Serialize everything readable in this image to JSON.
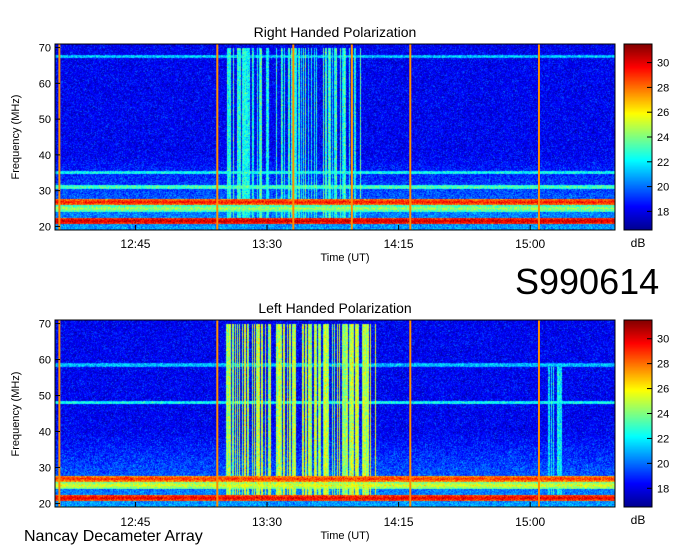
{
  "observation_id": "S990614",
  "instrument": "Nancay Decameter Array",
  "colors": {
    "colormap": [
      "#00008f",
      "#0000ff",
      "#0080ff",
      "#00ffff",
      "#80ff80",
      "#ffff00",
      "#ff8000",
      "#ff0000",
      "#800000"
    ],
    "background": "#ffffff",
    "axis": "#000000"
  },
  "chart_data": [
    {
      "type": "heatmap",
      "title": "Right Handed Polarization",
      "xlabel": "Time (UT)",
      "ylabel": "Frequency (MHz)",
      "x_tick_labels": [
        "12:45",
        "13:30",
        "14:15",
        "15:00"
      ],
      "x_ticks_minutes": [
        765,
        810,
        855,
        900
      ],
      "xlim_minutes": [
        737.5,
        929
      ],
      "y_ticks": [
        20,
        30,
        40,
        50,
        60,
        70
      ],
      "ylim": [
        19,
        71
      ],
      "colorbar": {
        "label": "dB",
        "ticks": [
          18,
          20,
          22,
          24,
          26,
          28,
          30
        ],
        "range": [
          16.5,
          31.5
        ]
      },
      "grid": false,
      "interference_lines_minutes": [
        739,
        793,
        819,
        839,
        859,
        903
      ],
      "band_levels_db": [
        {
          "freq_mhz": 21.5,
          "level": 30.5
        },
        {
          "freq_mhz": 26.8,
          "level": 29.5
        },
        {
          "freq_mhz": 25.0,
          "level": 24.5
        },
        {
          "freq_mhz": 31.0,
          "level": 23.5
        },
        {
          "freq_mhz": 35.0,
          "level": 22.5
        },
        {
          "freq_mhz": 67.5,
          "level": 21.5
        }
      ],
      "burst_activity": [
        {
          "start_minutes": 796,
          "end_minutes": 842,
          "fmin_mhz": 22,
          "fmax_mhz": 70,
          "peak_db": 23
        }
      ]
    },
    {
      "type": "heatmap",
      "title": "Left Handed Polarization",
      "xlabel": "Time (UT)",
      "ylabel": "Frequency (MHz)",
      "x_tick_labels": [
        "12:45",
        "13:30",
        "14:15",
        "15:00"
      ],
      "x_ticks_minutes": [
        765,
        810,
        855,
        900
      ],
      "xlim_minutes": [
        737.5,
        929
      ],
      "y_ticks": [
        20,
        30,
        40,
        50,
        60,
        70
      ],
      "ylim": [
        19,
        71
      ],
      "colorbar": {
        "label": "dB",
        "ticks": [
          18,
          20,
          22,
          24,
          26,
          28,
          30
        ],
        "range": [
          16.5,
          31.5
        ]
      },
      "grid": false,
      "interference_lines_minutes": [
        739,
        793,
        859,
        903
      ],
      "band_levels_db": [
        {
          "freq_mhz": 21.5,
          "level": 30.0
        },
        {
          "freq_mhz": 26.8,
          "level": 29.0
        },
        {
          "freq_mhz": 25.0,
          "level": 25.5
        },
        {
          "freq_mhz": 48.0,
          "level": 22.5
        },
        {
          "freq_mhz": 58.5,
          "level": 21.5
        }
      ],
      "burst_activity": [
        {
          "start_minutes": 794,
          "end_minutes": 848,
          "fmin_mhz": 22,
          "fmax_mhz": 70,
          "peak_db": 25
        },
        {
          "start_minutes": 906,
          "end_minutes": 911,
          "fmin_mhz": 22,
          "fmax_mhz": 58,
          "peak_db": 22
        }
      ]
    }
  ]
}
